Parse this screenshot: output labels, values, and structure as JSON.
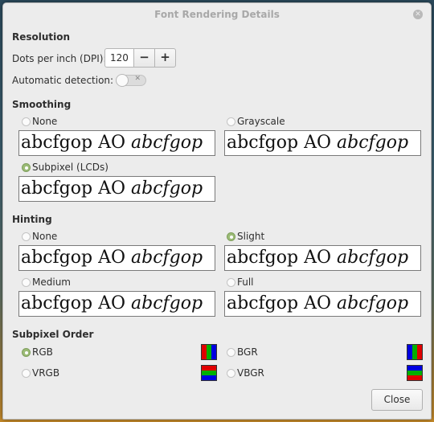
{
  "window": {
    "title": "Font Rendering Details"
  },
  "resolution": {
    "heading": "Resolution",
    "dpi_label": "Dots per inch (DPI):",
    "dpi_value": "120",
    "minus_label": "−",
    "plus_label": "+",
    "auto_label": "Automatic detection:",
    "auto_enabled": false
  },
  "sample": {
    "regular": "abcfgop AO",
    "italic": "abcfgop"
  },
  "smoothing": {
    "heading": "Smoothing",
    "options": [
      {
        "label": "None",
        "checked": false
      },
      {
        "label": "Grayscale",
        "checked": false
      },
      {
        "label": "Subpixel (LCDs)",
        "checked": true
      }
    ]
  },
  "hinting": {
    "heading": "Hinting",
    "options": [
      {
        "label": "None",
        "checked": false
      },
      {
        "label": "Slight",
        "checked": true
      },
      {
        "label": "Medium",
        "checked": false
      },
      {
        "label": "Full",
        "checked": false
      }
    ]
  },
  "subpixel_order": {
    "heading": "Subpixel Order",
    "options": [
      {
        "label": "RGB",
        "checked": true,
        "orientation": "horizontal",
        "colors": [
          "#e00000",
          "#00b000",
          "#0000e0"
        ]
      },
      {
        "label": "BGR",
        "checked": false,
        "orientation": "horizontal",
        "colors": [
          "#0000e0",
          "#00b000",
          "#e00000"
        ]
      },
      {
        "label": "VRGB",
        "checked": false,
        "orientation": "vertical",
        "colors": [
          "#e00000",
          "#00b000",
          "#0000e0"
        ]
      },
      {
        "label": "VBGR",
        "checked": false,
        "orientation": "vertical",
        "colors": [
          "#0000e0",
          "#00b000",
          "#e00000"
        ]
      }
    ]
  },
  "footer": {
    "close_label": "Close"
  }
}
